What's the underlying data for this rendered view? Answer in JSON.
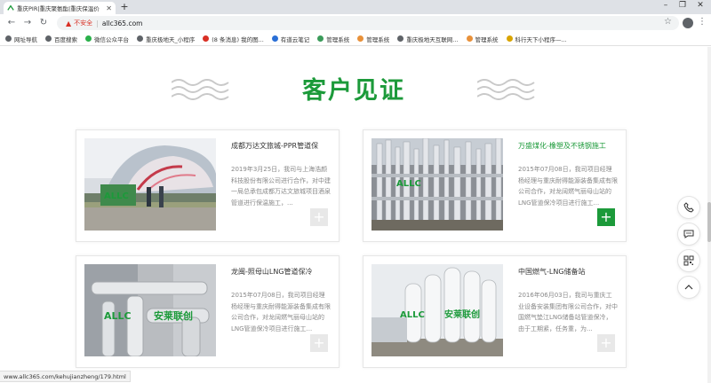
{
  "browser": {
    "tab_title": "重庆PIR|重庆聚氨酯|重庆保温价",
    "tab_close": "✕",
    "new_tab": "+",
    "not_secure": "不安全",
    "url": "allc365.com",
    "bookmarks": [
      {
        "label": "网址导航",
        "icon": "globe-icon",
        "color": "#5f6368"
      },
      {
        "label": "百度搜索",
        "icon": "globe-icon",
        "color": "#5f6368"
      },
      {
        "label": "微信公众平台",
        "icon": "wechat-icon",
        "color": "#2ab04a"
      },
      {
        "label": "重庆极地天_小程序",
        "icon": "globe-icon",
        "color": "#5f6368"
      },
      {
        "label": "(8 条消息) 我的图...",
        "icon": "x-icon",
        "color": "#d93025"
      },
      {
        "label": "有道云笔记",
        "icon": "note-icon",
        "color": "#2a6fd6"
      },
      {
        "label": "管理系统",
        "icon": "doc-icon",
        "color": "#3b9b5a"
      },
      {
        "label": "管理系统",
        "icon": "gear-icon",
        "color": "#e8913a"
      },
      {
        "label": "重庆极地天互联网...",
        "icon": "globe-icon",
        "color": "#5f6368"
      },
      {
        "label": "管理系统",
        "icon": "gear-icon",
        "color": "#e8913a"
      },
      {
        "label": "科行天下小程序—...",
        "icon": "v-icon",
        "color": "#d9a400"
      }
    ]
  },
  "section": {
    "title": "客户见证",
    "accent": "#1c9a3a"
  },
  "cards": [
    {
      "title": "成都万达文旅城-PPR管道保",
      "desc": "2019年3月25日，我司与上海浩颜科技股份有限公司进行合作，对中建一局总承包成都万达文旅城项目酒泉管道进行保温施工，...",
      "plus": "+",
      "active": false
    },
    {
      "title": "万盛煤化-橡塑及不锈钢施工",
      "desc": "2015年07月08日，我司项目经理杨经理与重庆耐得能源装备集成有限公司合作，对龙阔燃气丽母山站的LNG管道保冷项目进行施工...",
      "plus": "+",
      "active": true
    },
    {
      "title": "龙闽-照母山LNG管道保冷",
      "desc": "2015年07月08日，我司项目经理杨经理与重庆耐得能源装备集成有限公司合作，对龙阔燃气丽母山站的LNG管道保冷项目进行施工...",
      "plus": "+",
      "active": false
    },
    {
      "title": "中国燃气-LNG储备站",
      "desc": "2016年06月03日，我司与重庆工业设备安装集团有限公司合作，对中国燃气垫江LNG储备站管道保冷，由于工期紧，任务重，为...",
      "plus": "+",
      "active": false
    }
  ],
  "logo_text": "安莱联创",
  "status_url": "www.allc365.com/kehujianzheng/179.html"
}
